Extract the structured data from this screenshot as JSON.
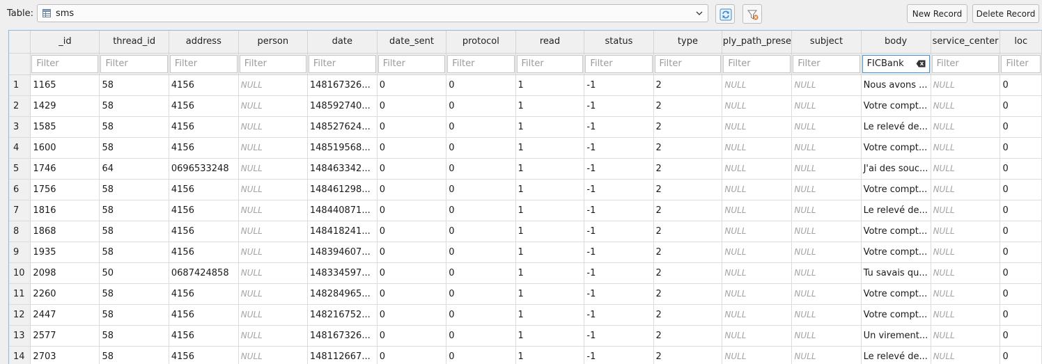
{
  "toolbar": {
    "table_label": "Table:",
    "selected_table": "sms",
    "new_record": "New Record",
    "delete_record": "Delete Record"
  },
  "grid": {
    "columns": [
      "_id",
      "thread_id",
      "address",
      "person",
      "date",
      "date_sent",
      "protocol",
      "read",
      "status",
      "type",
      "ply_path_prese",
      "subject",
      "body",
      "service_center",
      "loc"
    ],
    "filter_placeholder": "Filter",
    "active_filter_column": "body",
    "active_filter_value": "FICBank",
    "null_text": "NULL",
    "rows": [
      [
        "1",
        "1165",
        "58",
        "4156",
        null,
        "148167326...",
        "0",
        "0",
        "1",
        "-1",
        "2",
        null,
        null,
        "Nous avons ...",
        null,
        "0"
      ],
      [
        "2",
        "1429",
        "58",
        "4156",
        null,
        "148592740...",
        "0",
        "0",
        "1",
        "-1",
        "2",
        null,
        null,
        "Votre compt...",
        null,
        "0"
      ],
      [
        "3",
        "1585",
        "58",
        "4156",
        null,
        "148527624...",
        "0",
        "0",
        "1",
        "-1",
        "2",
        null,
        null,
        "Le relevé de...",
        null,
        "0"
      ],
      [
        "4",
        "1600",
        "58",
        "4156",
        null,
        "148519568...",
        "0",
        "0",
        "1",
        "-1",
        "2",
        null,
        null,
        "Votre compt...",
        null,
        "0"
      ],
      [
        "5",
        "1746",
        "64",
        "0696533248",
        null,
        "148463342...",
        "0",
        "0",
        "1",
        "-1",
        "2",
        null,
        null,
        "J'ai des souc...",
        null,
        "0"
      ],
      [
        "6",
        "1756",
        "58",
        "4156",
        null,
        "148461298...",
        "0",
        "0",
        "1",
        "-1",
        "2",
        null,
        null,
        "Votre compt...",
        null,
        "0"
      ],
      [
        "7",
        "1816",
        "58",
        "4156",
        null,
        "148440871...",
        "0",
        "0",
        "1",
        "-1",
        "2",
        null,
        null,
        "Le relevé de...",
        null,
        "0"
      ],
      [
        "8",
        "1868",
        "58",
        "4156",
        null,
        "148418241...",
        "0",
        "0",
        "1",
        "-1",
        "2",
        null,
        null,
        "Votre compt...",
        null,
        "0"
      ],
      [
        "9",
        "1935",
        "58",
        "4156",
        null,
        "148394607...",
        "0",
        "0",
        "1",
        "-1",
        "2",
        null,
        null,
        "Votre compt...",
        null,
        "0"
      ],
      [
        "10",
        "2098",
        "50",
        "0687424858",
        null,
        "148334597...",
        "0",
        "0",
        "1",
        "-1",
        "2",
        null,
        null,
        "Tu savais qu...",
        null,
        "0"
      ],
      [
        "11",
        "2260",
        "58",
        "4156",
        null,
        "148284965...",
        "0",
        "0",
        "1",
        "-1",
        "2",
        null,
        null,
        "Votre compt...",
        null,
        "0"
      ],
      [
        "12",
        "2447",
        "58",
        "4156",
        null,
        "148216752...",
        "0",
        "0",
        "1",
        "-1",
        "2",
        null,
        null,
        "Votre compt...",
        null,
        "0"
      ],
      [
        "13",
        "2577",
        "58",
        "4156",
        null,
        "148167326...",
        "0",
        "0",
        "1",
        "-1",
        "2",
        null,
        null,
        "Un virement...",
        null,
        "0"
      ],
      [
        "14",
        "2703",
        "58",
        "4156",
        null,
        "148112667...",
        "0",
        "0",
        "1",
        "-1",
        "2",
        null,
        null,
        "Le relevé de...",
        null,
        "0"
      ]
    ]
  },
  "colors": {
    "accent": "#3d8fd6",
    "refresh_icon": "#3a87c8",
    "clear_filter_badge": "#e0752a"
  },
  "icons": {
    "table": "table-icon",
    "dropdown": "chevron-down-icon",
    "refresh": "refresh-icon",
    "clear_filters": "clear-filters-icon",
    "clear_text": "clear-text-icon"
  }
}
